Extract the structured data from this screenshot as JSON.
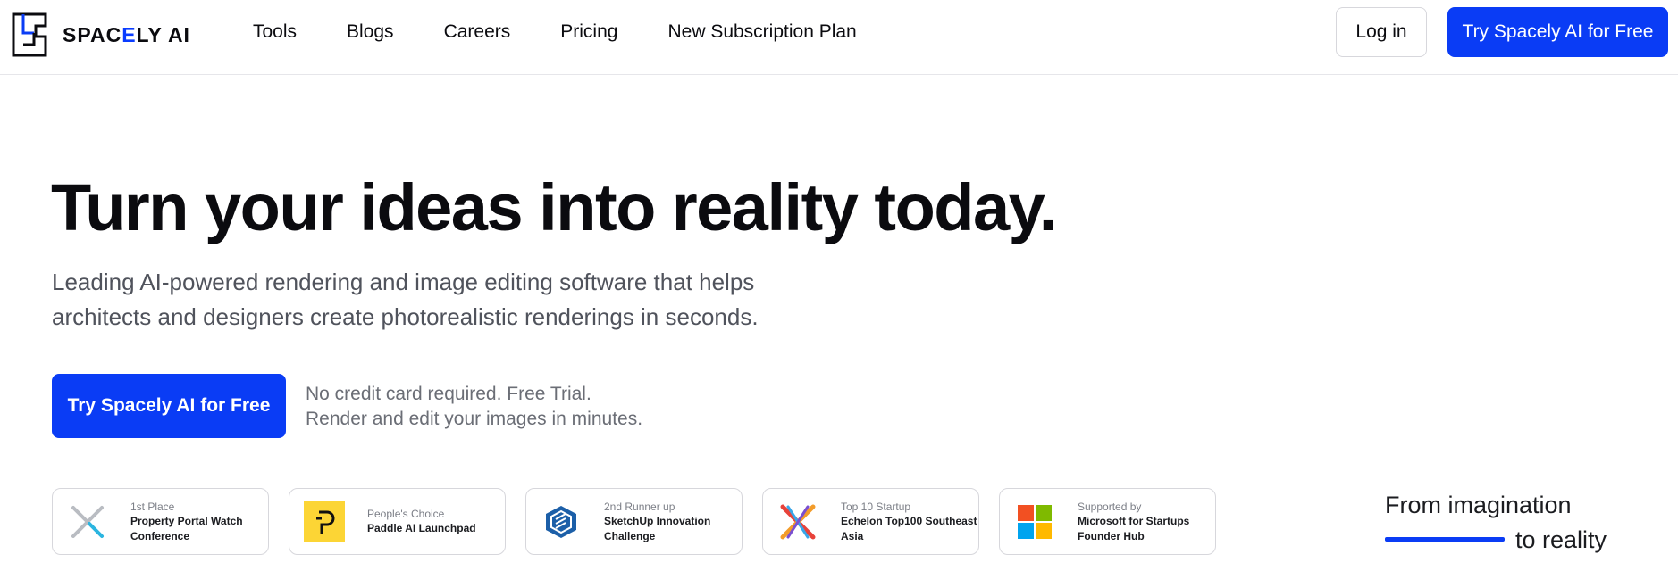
{
  "brand": {
    "name_prefix": "SPAC",
    "name_accent": "E",
    "name_suffix": "LY AI",
    "accent_color": "#0a3cf5"
  },
  "nav": {
    "links": [
      "Tools",
      "Blogs",
      "Careers",
      "Pricing",
      "New Subscription Plan"
    ],
    "login_label": "Log in",
    "cta_label": "Try Spacely AI for Free"
  },
  "hero": {
    "title": "Turn your ideas into reality today.",
    "subtitle_line1": "Leading AI-powered rendering and image editing software that helps",
    "subtitle_line2": "architects and designers create photorealistic renderings in seconds.",
    "cta_label": "Try Spacely AI for Free",
    "note_line1": "No credit card required. Free Trial.",
    "note_line2": "Render and edit your images in minutes."
  },
  "awards": [
    {
      "place": "1st Place",
      "name": "Property Portal Watch Conference",
      "icon": "ppw-x-icon"
    },
    {
      "place": "People's Choice",
      "name": "Paddle AI Launchpad",
      "icon": "paddle-icon"
    },
    {
      "place": "2nd Runner up",
      "name": "SketchUp Innovation Challenge",
      "icon": "sketchup-icon"
    },
    {
      "place": "Top 10 Startup",
      "name": "Echelon Top100 Southeast Asia",
      "icon": "echelon-icon"
    },
    {
      "place": "Supported by",
      "name": "Microsoft for Startups Founder Hub",
      "icon": "microsoft-icon"
    }
  ],
  "tagline": {
    "top": "From imagination",
    "bottom": "to reality"
  }
}
